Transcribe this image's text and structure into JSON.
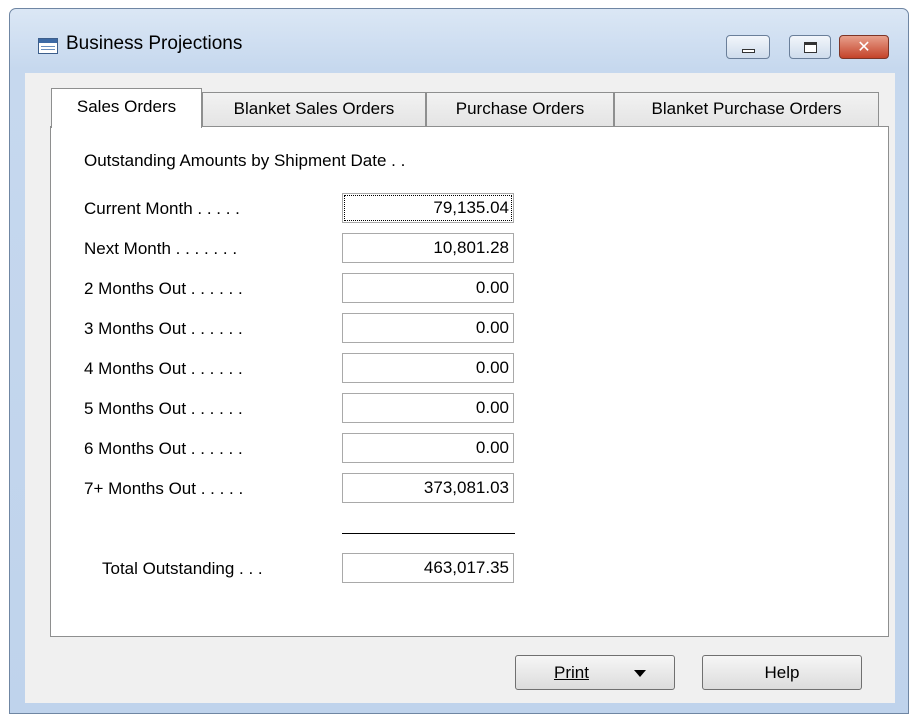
{
  "window": {
    "title": "Business Projections"
  },
  "tabs": [
    {
      "label": "Sales Orders",
      "active": true
    },
    {
      "label": "Blanket Sales Orders",
      "active": false
    },
    {
      "label": "Purchase Orders",
      "active": false
    },
    {
      "label": "Blanket Purchase Orders",
      "active": false
    }
  ],
  "panel": {
    "heading": "Outstanding Amounts by Shipment Date . .",
    "rows": [
      {
        "label": "Current Month . . . . .",
        "value": "79,135.04"
      },
      {
        "label": "Next Month . . . . . . .",
        "value": "10,801.28"
      },
      {
        "label": "2 Months Out . . . . . .",
        "value": "0.00"
      },
      {
        "label": "3 Months Out . . . . . .",
        "value": "0.00"
      },
      {
        "label": "4 Months Out . . . . . .",
        "value": "0.00"
      },
      {
        "label": "5 Months Out . . . . . .",
        "value": "0.00"
      },
      {
        "label": "6 Months Out . . . . . .",
        "value": "0.00"
      },
      {
        "label": "7+ Months Out . . . . .",
        "value": "373,081.03"
      }
    ],
    "total": {
      "label": "Total Outstanding . . .",
      "value": "463,017.35"
    }
  },
  "buttons": {
    "print": "Print",
    "help": "Help",
    "close_glyph": "✕"
  },
  "icons": {
    "app": "table-icon",
    "minimize": "minimize-icon",
    "maximize": "maximize-icon",
    "close": "close-icon",
    "dropdown": "dropdown-arrow-icon"
  },
  "colors": {
    "close_button": "#c4432a",
    "titlebar": "#c6d8ee",
    "panel": "#ffffff"
  }
}
